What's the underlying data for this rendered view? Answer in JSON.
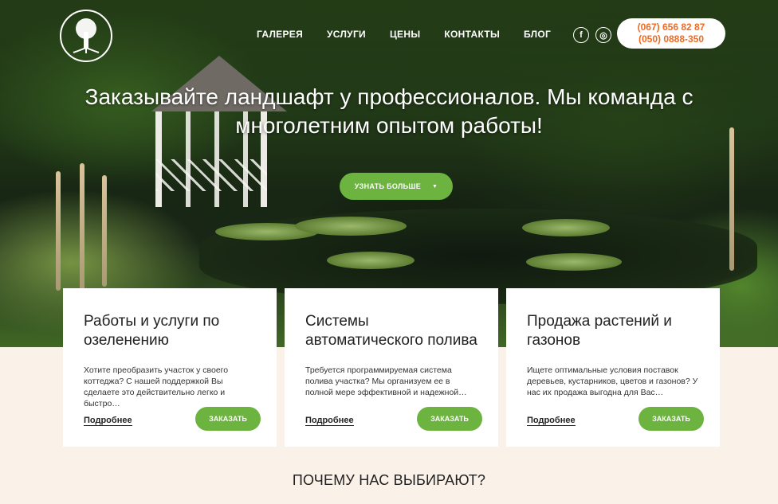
{
  "header": {
    "logo_icon": "tree-icon",
    "nav": [
      "ГАЛЕРЕЯ",
      "УСЛУГИ",
      "ЦЕНЫ",
      "КОНТАКТЫ",
      "БЛОГ"
    ],
    "social": [
      {
        "icon": "facebook-icon",
        "glyph": "f"
      },
      {
        "icon": "instagram-icon",
        "glyph": "◎"
      }
    ],
    "phones": [
      "(067) 656 82 87",
      "(050) 0888-350"
    ]
  },
  "hero": {
    "headline": "Заказывайте ландшафт у профессионалов. Мы команда с многолетним опытом работы!",
    "cta_label": "УЗНАТЬ БОЛЬШЕ",
    "cta_caret": "▼"
  },
  "cards": [
    {
      "title": "Работы и услуги по озеленению",
      "text": "Хотите преобразить участок у своего коттеджа? С нашей поддержкой Вы сделаете это действительно легко и быстро…",
      "more": "Подробнее",
      "order": "ЗАКАЗАТЬ"
    },
    {
      "title": "Системы автоматического полива",
      "text": "Требуется программируемая система полива участка? Мы организуем ее в полной мере эффективной и надежной…",
      "more": "Подробнее",
      "order": "ЗАКАЗАТЬ"
    },
    {
      "title": "Продажа растений и газонов",
      "text": "Ищете оптимальные условия поставок деревьев, кустарников, цветов и газонов? У нас их продажа выгодна для Вас…",
      "more": "Подробнее",
      "order": "ЗАКАЗАТЬ"
    }
  ],
  "section_title": "ПОЧЕМУ НАС ВЫБИРАЮТ?",
  "colors": {
    "accent_green": "#6cb33f",
    "phone_orange": "#f26a21",
    "page_bg": "#faf1e8"
  }
}
